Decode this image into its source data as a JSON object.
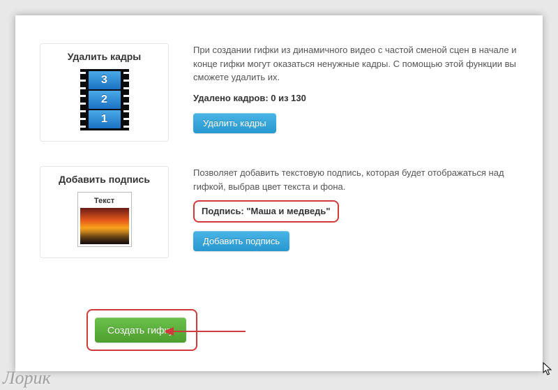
{
  "section1": {
    "card_title": "Удалить кадры",
    "frames": [
      "3",
      "2",
      "1"
    ],
    "description": "При создании гифки из динамичного видео с частой сменой сцен в начале и конце гифки могут оказаться ненужные кадры. С помощью этой функции вы сможете удалить их.",
    "status": "Удалено кадров: 0 из 130",
    "button": "Удалить кадры"
  },
  "section2": {
    "card_title": "Добавить подпись",
    "photo_caption": "Текст",
    "description": "Позволяет добавить текстовую подпись, которая будет отображаться над гифкой, выбрав цвет текста и фона.",
    "status": "Подпись: \"Маша и медведь\"",
    "button": "Добавить подпись"
  },
  "create_button": "Создать гифку",
  "watermark": "Лорик"
}
